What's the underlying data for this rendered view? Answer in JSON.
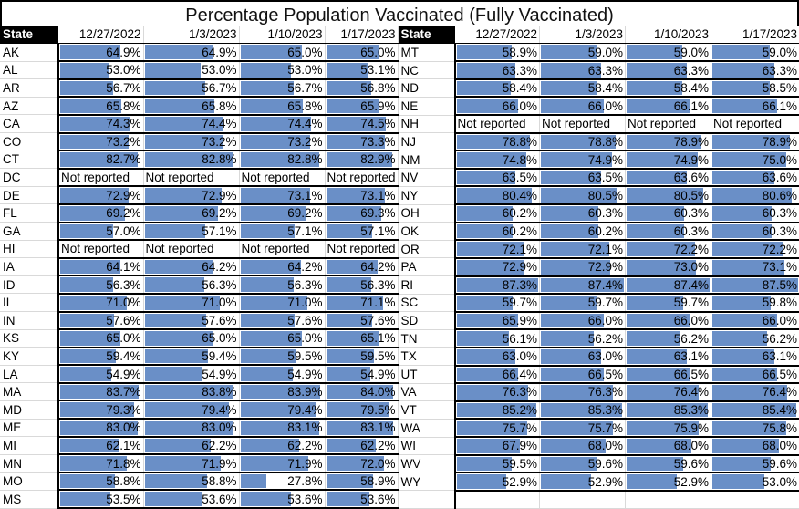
{
  "title": "Percentage Population Vaccinated (Fully Vaccinated)",
  "bar_color": "#6a8fc7",
  "not_reported_label": "Not reported",
  "columns": [
    "State",
    "12/27/2022",
    "1/3/2023",
    "1/10/2023",
    "1/17/2023"
  ],
  "left": [
    {
      "state": "AK",
      "values": [
        "64.9%",
        "64.9%",
        "65.0%",
        "65.0%"
      ]
    },
    {
      "state": "AL",
      "values": [
        "53.0%",
        "53.0%",
        "53.0%",
        "53.1%"
      ]
    },
    {
      "state": "AR",
      "values": [
        "56.7%",
        "56.7%",
        "56.7%",
        "56.8%"
      ]
    },
    {
      "state": "AZ",
      "values": [
        "65.8%",
        "65.8%",
        "65.8%",
        "65.9%"
      ]
    },
    {
      "state": "CA",
      "values": [
        "74.3%",
        "74.4%",
        "74.4%",
        "74.5%"
      ]
    },
    {
      "state": "CO",
      "values": [
        "73.2%",
        "73.2%",
        "73.2%",
        "73.3%"
      ]
    },
    {
      "state": "CT",
      "values": [
        "82.7%",
        "82.8%",
        "82.8%",
        "82.9%"
      ]
    },
    {
      "state": "DC",
      "values": [
        "Not reported",
        "Not reported",
        "Not reported",
        "Not reported"
      ]
    },
    {
      "state": "DE",
      "values": [
        "72.9%",
        "72.9%",
        "73.1%",
        "73.1%"
      ]
    },
    {
      "state": "FL",
      "values": [
        "69.2%",
        "69.2%",
        "69.2%",
        "69.3%"
      ]
    },
    {
      "state": "GA",
      "values": [
        "57.0%",
        "57.1%",
        "57.1%",
        "57.1%"
      ]
    },
    {
      "state": "HI",
      "values": [
        "Not reported",
        "Not reported",
        "Not reported",
        "Not reported"
      ]
    },
    {
      "state": "IA",
      "values": [
        "64.1%",
        "64.2%",
        "64.2%",
        "64.2%"
      ]
    },
    {
      "state": "ID",
      "values": [
        "56.3%",
        "56.3%",
        "56.3%",
        "56.3%"
      ]
    },
    {
      "state": "IL",
      "values": [
        "71.0%",
        "71.0%",
        "71.0%",
        "71.1%"
      ]
    },
    {
      "state": "IN",
      "values": [
        "57.6%",
        "57.6%",
        "57.6%",
        "57.6%"
      ]
    },
    {
      "state": "KS",
      "values": [
        "65.0%",
        "65.0%",
        "65.0%",
        "65.1%"
      ]
    },
    {
      "state": "KY",
      "values": [
        "59.4%",
        "59.4%",
        "59.5%",
        "59.5%"
      ]
    },
    {
      "state": "LA",
      "values": [
        "54.9%",
        "54.9%",
        "54.9%",
        "54.9%"
      ]
    },
    {
      "state": "MA",
      "values": [
        "83.7%",
        "83.8%",
        "83.9%",
        "84.0%"
      ]
    },
    {
      "state": "MD",
      "values": [
        "79.3%",
        "79.4%",
        "79.4%",
        "79.5%"
      ]
    },
    {
      "state": "ME",
      "values": [
        "83.0%",
        "83.0%",
        "83.1%",
        "83.1%"
      ]
    },
    {
      "state": "MI",
      "values": [
        "62.1%",
        "62.2%",
        "62.2%",
        "62.2%"
      ]
    },
    {
      "state": "MN",
      "values": [
        "71.8%",
        "71.9%",
        "71.9%",
        "72.0%"
      ]
    },
    {
      "state": "MO",
      "values": [
        "58.8%",
        "58.8%",
        "27.8%",
        "58.9%"
      ]
    },
    {
      "state": "MS",
      "values": [
        "53.5%",
        "53.6%",
        "53.6%",
        "53.6%"
      ]
    }
  ],
  "right": [
    {
      "state": "MT",
      "values": [
        "58.9%",
        "59.0%",
        "59.0%",
        "59.0%"
      ]
    },
    {
      "state": "NC",
      "values": [
        "63.3%",
        "63.3%",
        "63.3%",
        "63.3%"
      ]
    },
    {
      "state": "ND",
      "values": [
        "58.4%",
        "58.4%",
        "58.4%",
        "58.5%"
      ]
    },
    {
      "state": "NE",
      "values": [
        "66.0%",
        "66.0%",
        "66.1%",
        "66.1%"
      ]
    },
    {
      "state": "NH",
      "values": [
        "Not reported",
        "Not reported",
        "Not reported",
        "Not reported"
      ]
    },
    {
      "state": "NJ",
      "values": [
        "78.8%",
        "78.8%",
        "78.9%",
        "78.9%"
      ]
    },
    {
      "state": "NM",
      "values": [
        "74.8%",
        "74.9%",
        "74.9%",
        "75.0%"
      ]
    },
    {
      "state": "NV",
      "values": [
        "63.5%",
        "63.5%",
        "63.6%",
        "63.6%"
      ]
    },
    {
      "state": "NY",
      "values": [
        "80.4%",
        "80.5%",
        "80.5%",
        "80.6%"
      ]
    },
    {
      "state": "OH",
      "values": [
        "60.2%",
        "60.3%",
        "60.3%",
        "60.3%"
      ]
    },
    {
      "state": "OK",
      "values": [
        "60.2%",
        "60.2%",
        "60.3%",
        "60.3%"
      ]
    },
    {
      "state": "OR",
      "values": [
        "72.1%",
        "72.1%",
        "72.2%",
        "72.2%"
      ]
    },
    {
      "state": "PA",
      "values": [
        "72.9%",
        "72.9%",
        "73.0%",
        "73.1%"
      ]
    },
    {
      "state": "RI",
      "values": [
        "87.3%",
        "87.4%",
        "87.4%",
        "87.5%"
      ]
    },
    {
      "state": "SC",
      "values": [
        "59.7%",
        "59.7%",
        "59.7%",
        "59.8%"
      ]
    },
    {
      "state": "SD",
      "values": [
        "65.9%",
        "66.0%",
        "66.0%",
        "66.0%"
      ]
    },
    {
      "state": "TN",
      "values": [
        "56.1%",
        "56.2%",
        "56.2%",
        "56.2%"
      ]
    },
    {
      "state": "TX",
      "values": [
        "63.0%",
        "63.0%",
        "63.1%",
        "63.1%"
      ]
    },
    {
      "state": "UT",
      "values": [
        "66.4%",
        "66.5%",
        "66.5%",
        "66.5%"
      ]
    },
    {
      "state": "VA",
      "values": [
        "76.3%",
        "76.3%",
        "76.4%",
        "76.4%"
      ]
    },
    {
      "state": "VT",
      "values": [
        "85.2%",
        "85.3%",
        "85.3%",
        "85.4%"
      ]
    },
    {
      "state": "WA",
      "values": [
        "75.7%",
        "75.7%",
        "75.9%",
        "75.8%"
      ]
    },
    {
      "state": "WI",
      "values": [
        "67.9%",
        "68.0%",
        "68.0%",
        "68.0%"
      ]
    },
    {
      "state": "WV",
      "values": [
        "59.5%",
        "59.6%",
        "59.6%",
        "59.6%"
      ]
    },
    {
      "state": "WY",
      "values": [
        "52.9%",
        "52.9%",
        "52.9%",
        "53.0%"
      ]
    }
  ],
  "bar_scale_max_percent": 87.5
}
